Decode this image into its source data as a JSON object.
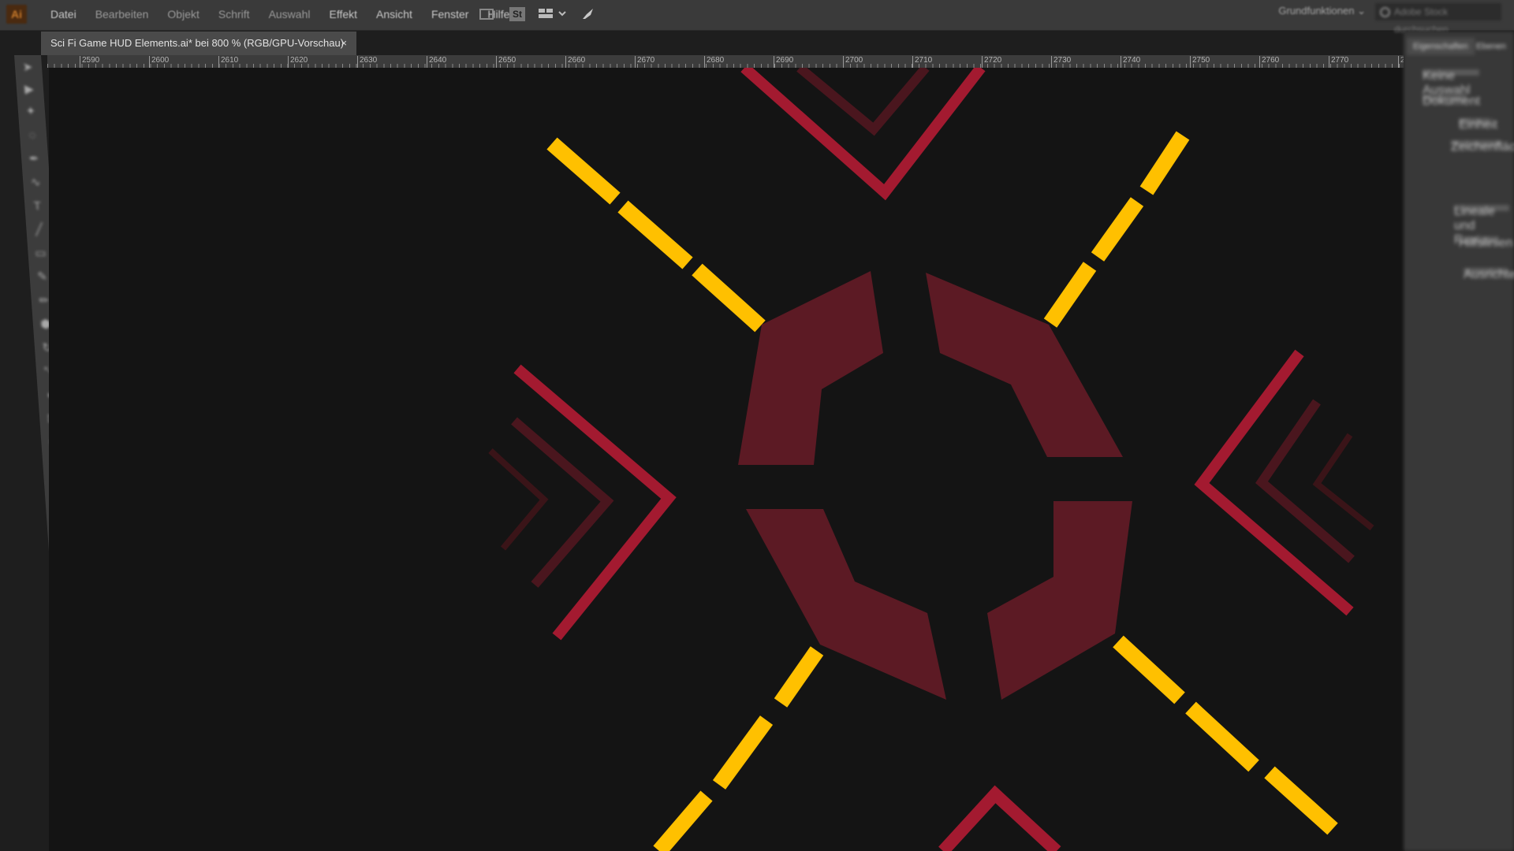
{
  "app": {
    "logo": "Ai"
  },
  "menu": {
    "items": [
      "Datei",
      "Bearbeiten",
      "Objekt",
      "Schrift",
      "Auswahl",
      "Effekt",
      "Ansicht",
      "Fenster",
      "Hilfe"
    ]
  },
  "toolbar_icons": [
    "layout-icon",
    "stock-icon",
    "arrange-icon",
    "chevron-down-icon",
    "rocket-icon"
  ],
  "workspace": {
    "label": "Grundfunktionen"
  },
  "search": {
    "placeholder": "Adobe Stock durchsuchen"
  },
  "document_tab": {
    "title": "Sci Fi Game HUD Elements.ai* bei 800 % (RGB/GPU-Vorschau)",
    "close": "×"
  },
  "ruler": {
    "labels": [
      "2590",
      "2600",
      "2610",
      "2620",
      "2630",
      "2640",
      "2650",
      "2660",
      "2670",
      "2680",
      "2690",
      "2700",
      "2710",
      "2720",
      "2730",
      "2740",
      "2750",
      "2760",
      "2770",
      "2780"
    ]
  },
  "right_panel": {
    "tabs": [
      "Eigenschaften",
      "Ebenen"
    ],
    "rows": [
      "Keine Auswahl",
      "Dokument",
      "Einheit",
      "Zeichenfläche",
      "Lineale und Raster",
      "Hilfslinien",
      "Ausrichten"
    ]
  },
  "artwork": {
    "colors": {
      "yellow": "#ffc000",
      "red": "#a31a30",
      "dark_red": "#5c1a24",
      "darker_red": "#4a161e",
      "darkest_red": "#3a1418",
      "background": "#141414"
    }
  }
}
